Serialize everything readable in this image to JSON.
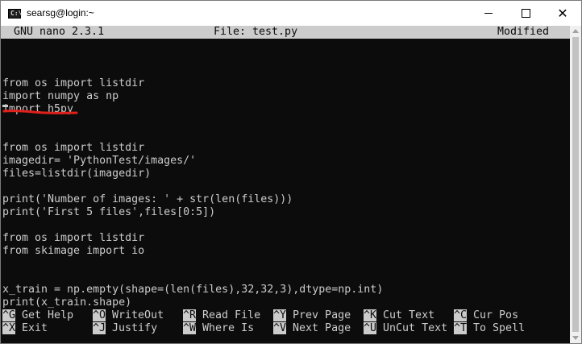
{
  "window": {
    "title": "searsg@login:~",
    "icon": "command-prompt-icon",
    "icon_glyph": "C:\\"
  },
  "nano_header": {
    "version": "GNU nano 2.3.1",
    "file": "File: test.py",
    "status": "Modified"
  },
  "code_lines": [
    "",
    "from os import listdir",
    "import numpy as np",
    "import h5py",
    "",
    "",
    "from os import listdir",
    "imagedir= 'PythonTest/images/'",
    "files=listdir(imagedir)",
    "",
    "print('Number of images: ' + str(len(files)))",
    "print('First 5 files',files[0:5])",
    "",
    "from os import listdir",
    "from skimage import io",
    "",
    "",
    "x_train = np.empty(shape=(len(files),32,32,3),dtype=np.int)",
    "print(x_train.shape)"
  ],
  "shortcuts": {
    "row1": [
      {
        "key": "^G",
        "label": "Get Help"
      },
      {
        "key": "^O",
        "label": "WriteOut"
      },
      {
        "key": "^R",
        "label": "Read File"
      },
      {
        "key": "^Y",
        "label": "Prev Page"
      },
      {
        "key": "^K",
        "label": "Cut Text"
      },
      {
        "key": "^C",
        "label": "Cur Pos"
      }
    ],
    "row2": [
      {
        "key": "^X",
        "label": "Exit"
      },
      {
        "key": "^J",
        "label": "Justify"
      },
      {
        "key": "^W",
        "label": "Where Is"
      },
      {
        "key": "^V",
        "label": "Next Page"
      },
      {
        "key": "^U",
        "label": "UnCut Text"
      },
      {
        "key": "^T",
        "label": "To Spell"
      }
    ]
  },
  "colors": {
    "terminal_bg": "#0c0c0c",
    "terminal_fg": "#cccccc",
    "annotation": "#e0201b"
  }
}
